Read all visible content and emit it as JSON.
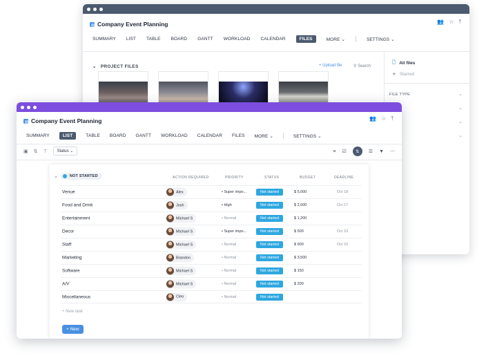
{
  "back_window": {
    "project_title": "Company Event Planning",
    "tabs": [
      "SUMMARY",
      "LIST",
      "TABLE",
      "BOARD",
      "GANTT",
      "WORKLOAD",
      "CALENDAR",
      "FILES",
      "MORE ⌄",
      "SETTINGS ⌄"
    ],
    "active_tab": "FILES",
    "section_title": "PROJECT FILES",
    "upload_label": "+ Upload file",
    "search_label": "Search",
    "sidebar": {
      "all_files": "All files",
      "starred": "Starred",
      "file_type": "FILE TYPE"
    },
    "thumbnail_icons": [
      "conference-hall-photo",
      "exhibition-photo",
      "concert-crowd-photo",
      "presentation-photo"
    ]
  },
  "front_window": {
    "project_title": "Company Event Planning",
    "tabs": [
      "SUMMARY",
      "LIST",
      "TABLE",
      "BOARD",
      "GANTT",
      "WORKLOAD",
      "CALENDAR",
      "FILES",
      "MORE ⌄",
      "SETTINGS ⌄"
    ],
    "active_tab": "LIST",
    "status_filter": "Status ⌄",
    "group": {
      "label": "NOT STARTED",
      "color": "#2ea7e0"
    },
    "columns": {
      "action": "ACTION REQUIRED",
      "priority": "PRIORITY",
      "status": "STATUS",
      "budget": "BUDGET",
      "deadline": "DEADLINE"
    },
    "rows": [
      {
        "name": "Venue",
        "assignee": "Alex",
        "priority": "• Super impo...",
        "status": "Not started",
        "budget": "$  5,000",
        "deadline": "Oct 18"
      },
      {
        "name": "Food and Drink",
        "assignee": "Josh",
        "priority": "• High",
        "status": "Not started",
        "budget": "$  2,000",
        "deadline": "Oct 17"
      },
      {
        "name": "Entertainment",
        "assignee": "Michael S",
        "priority": "• Normal",
        "status": "Not started",
        "budget": "$  1,200",
        "deadline": ""
      },
      {
        "name": "Decor",
        "assignee": "Michael S",
        "priority": "• Super impo...",
        "status": "Not started",
        "budget": "$  500",
        "deadline": "Oct 23"
      },
      {
        "name": "Staff",
        "assignee": "Michael S",
        "priority": "• Normal",
        "status": "Not started",
        "budget": "$  600",
        "deadline": "Oct 22"
      },
      {
        "name": "Marketing",
        "assignee": "Brandon",
        "priority": "• Normal",
        "status": "Not started",
        "budget": "$  3,500",
        "deadline": ""
      },
      {
        "name": "Software",
        "assignee": "Michael S",
        "priority": "• Normal",
        "status": "Not started",
        "budget": "$  150",
        "deadline": ""
      },
      {
        "name": "A/V",
        "assignee": "Michael S",
        "priority": "• Normal",
        "status": "Not started",
        "budget": "$  200",
        "deadline": ""
      },
      {
        "name": "Miscellaneous",
        "assignee": "Cleo",
        "priority": "• Normal",
        "status": "Not started",
        "budget": "",
        "deadline": ""
      }
    ],
    "new_task_label": "+ New task",
    "new_button_label": "+ New"
  },
  "colors": {
    "back_titlebar": "#4b5a6e",
    "front_titlebar": "#7c4dde",
    "status_badge": "#2ea7e0",
    "accent": "#4a90e2"
  }
}
